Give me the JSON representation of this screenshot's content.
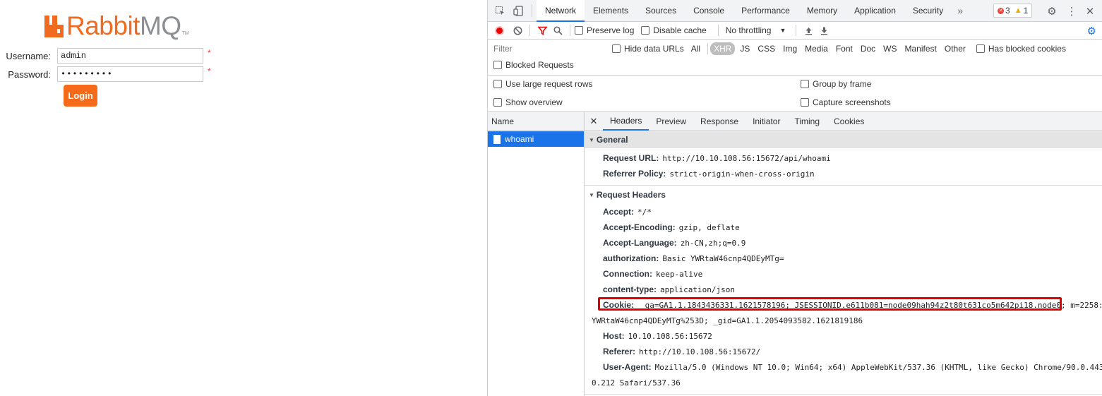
{
  "login_page": {
    "logo": {
      "brand": "Rabbit",
      "brand_suffix": "MQ",
      "trademark": "TM"
    },
    "username_label": "Username:",
    "username_value": "admin",
    "password_label": "Password:",
    "password_value": "•••••••••",
    "required_marker": "*",
    "login_button": "Login"
  },
  "devtools": {
    "tabs": [
      "Network",
      "Elements",
      "Sources",
      "Console",
      "Performance",
      "Memory",
      "Application",
      "Security"
    ],
    "active_tab": "Network",
    "more_tabs": "»",
    "errors_count": "3",
    "warnings_count": "1",
    "toolbar": {
      "preserve_log": "Preserve log",
      "disable_cache": "Disable cache",
      "throttling": "No throttling"
    },
    "filter": {
      "placeholder": "Filter",
      "hide_data_urls": "Hide data URLs",
      "types": [
        "All",
        "XHR",
        "JS",
        "CSS",
        "Img",
        "Media",
        "Font",
        "Doc",
        "WS",
        "Manifest",
        "Other"
      ],
      "active_type": "XHR",
      "has_blocked_cookies": "Has blocked cookies",
      "blocked_requests": "Blocked Requests"
    },
    "settings": {
      "use_large_rows": "Use large request rows",
      "group_by_frame": "Group by frame",
      "show_overview": "Show overview",
      "capture_screenshots": "Capture screenshots"
    },
    "name_column": {
      "header": "Name",
      "request": "whoami"
    },
    "detail_tabs": [
      "Headers",
      "Preview",
      "Response",
      "Initiator",
      "Timing",
      "Cookies"
    ],
    "active_detail_tab": "Headers",
    "general": {
      "title": "General",
      "request_url_key": "Request URL:",
      "request_url_val": "http://10.10.108.56:15672/api/whoami",
      "referrer_policy_key": "Referrer Policy:",
      "referrer_policy_val": "strict-origin-when-cross-origin"
    },
    "request_headers": {
      "title": "Request Headers",
      "accept_key": "Accept:",
      "accept_val": "*/*",
      "accept_encoding_key": "Accept-Encoding:",
      "accept_encoding_val": "gzip, deflate",
      "accept_language_key": "Accept-Language:",
      "accept_language_val": "zh-CN,zh;q=0.9",
      "authorization_key": "authorization:",
      "authorization_val": "Basic YWRtaW46cnp4QDEyMTg=",
      "connection_key": "Connection:",
      "connection_val": "keep-alive",
      "content_type_key": "content-type:",
      "content_type_val": "application/json",
      "cookie_key": "Cookie:",
      "cookie_val": "_ga=GA1.1.1843436331.1621578196; JSESSIONID.e611b081=node09hah94z2t80t631co5m642pi18.node0; m=2258:",
      "cookie_cont": "YWRtaW46cnp4QDEyMTg%253D; _gid=GA1.1.2054093582.1621819186",
      "host_key": "Host:",
      "host_val": "10.10.108.56:15672",
      "referer_key": "Referer:",
      "referer_val": "http://10.10.108.56:15672/",
      "user_agent_key": "User-Agent:",
      "user_agent_val": "Mozilla/5.0 (Windows NT 10.0; Win64; x64) AppleWebKit/537.36 (KHTML, like Gecko) Chrome/90.0.443",
      "user_agent_cont": "0.212 Safari/537.36"
    },
    "colors": {
      "accent": "#1a73e8",
      "highlight": "#e00000",
      "brand_orange": "#f66a1b"
    }
  }
}
